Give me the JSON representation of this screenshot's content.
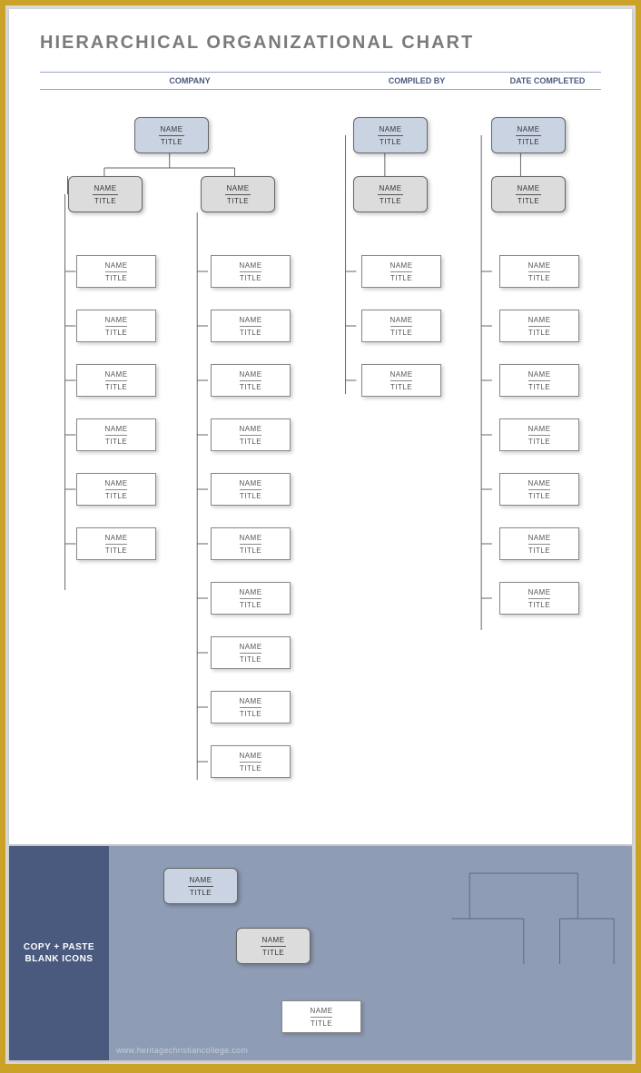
{
  "title": "HIERARCHICAL ORGANIZATIONAL CHART",
  "meta": {
    "company": "COMPANY",
    "compiled": "COMPILED BY",
    "date": "DATE COMPLETED"
  },
  "labels": {
    "name": "NAME",
    "title": "TITLE"
  },
  "page2": {
    "heading1": "COPY + PASTE",
    "heading2": "BLANK ICONS"
  },
  "watermark": "www.heritagechristiancollege.com"
}
